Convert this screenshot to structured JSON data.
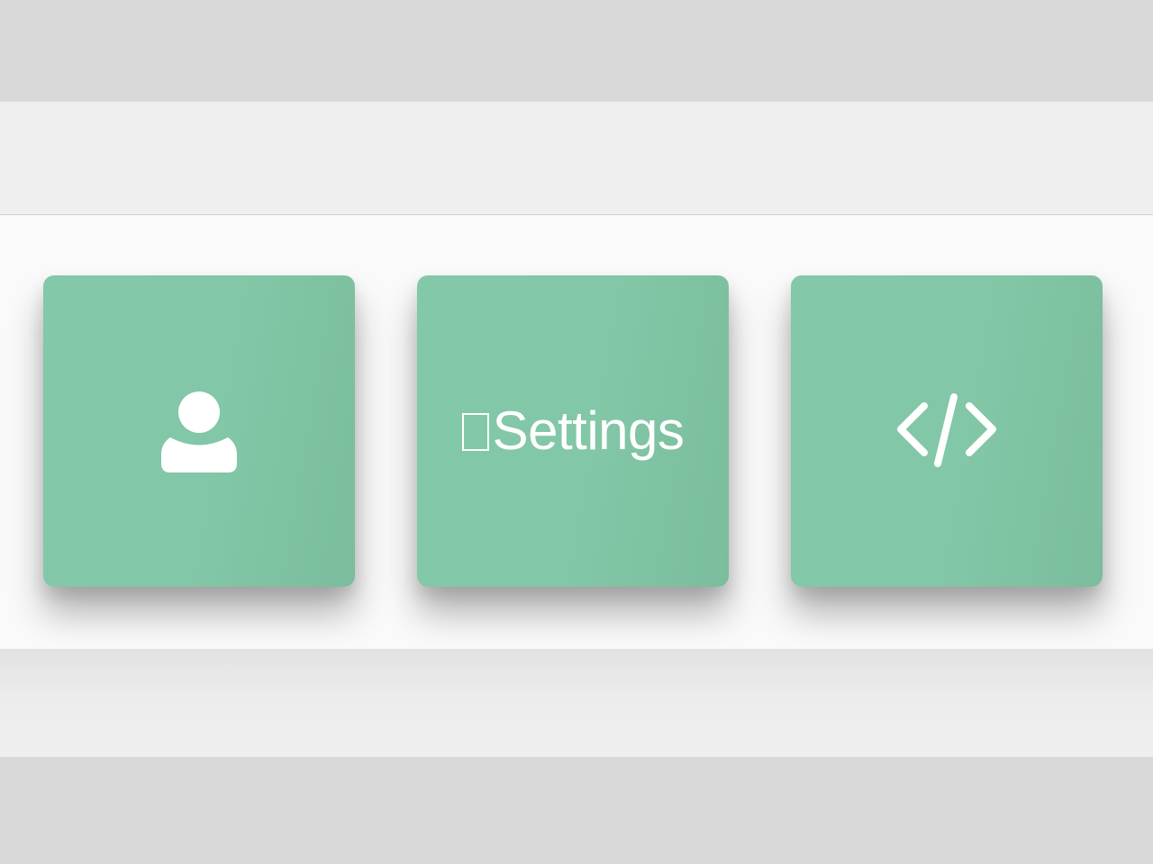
{
  "tiles": [
    {
      "icon": "user-icon",
      "label": ""
    },
    {
      "icon": "missing-glyph-icon",
      "label": "Settings"
    },
    {
      "icon": "code-icon",
      "label": ""
    }
  ],
  "colors": {
    "tile_bg": "#82c7a7",
    "page_bg": "#d9d9d9",
    "band_bg": "#efefef",
    "panel_bg": "#fafafa",
    "icon_fg": "#ffffff"
  }
}
